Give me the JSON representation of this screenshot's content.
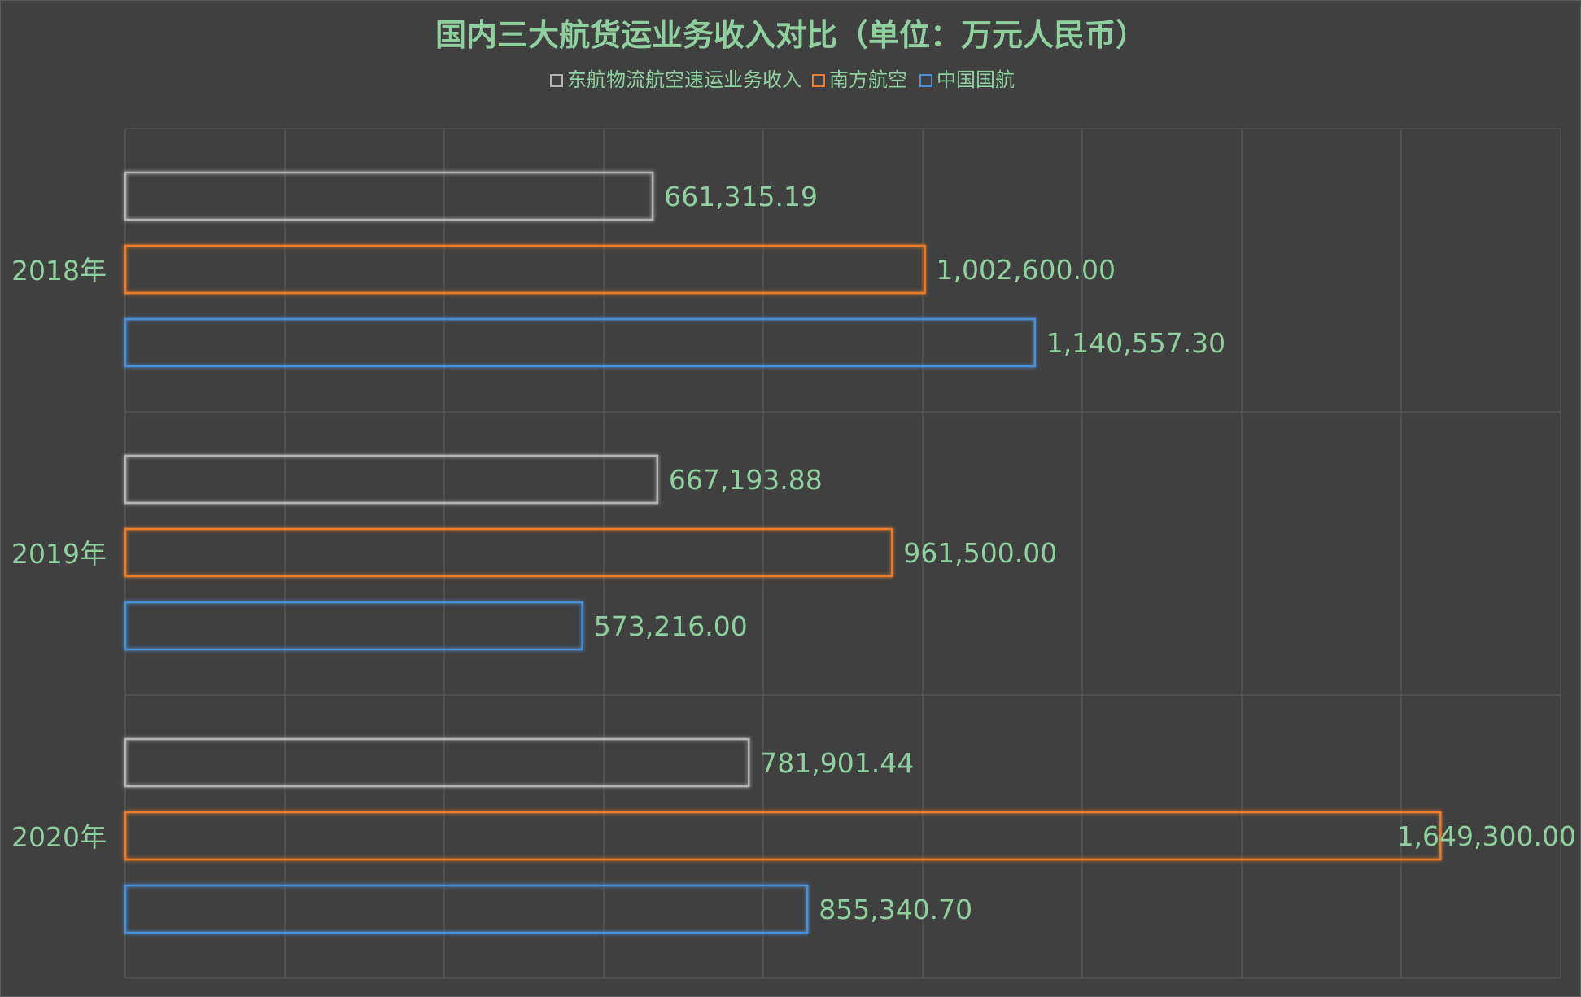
{
  "chart_data": {
    "type": "bar",
    "orientation": "horizontal",
    "title": "国内三大航货运业务收入对比（单位：万元人民币）",
    "categories": [
      "2018年",
      "2019年",
      "2020年"
    ],
    "series": [
      {
        "name": "东航物流航空速运业务收入",
        "color": "#b4b4b4",
        "values": [
          661315.19,
          667193.88,
          781901.44
        ],
        "labels": [
          "661,315.19",
          "667,193.88",
          "781,901.44"
        ]
      },
      {
        "name": "南方航空",
        "color": "#e87b2c",
        "values": [
          1002600.0,
          961500.0,
          1649300.0
        ],
        "labels": [
          "1,002,600.00",
          "961,500.00",
          "1,649,300.00"
        ]
      },
      {
        "name": "中国国航",
        "color": "#4c8fd6",
        "values": [
          1140557.3,
          573216.0,
          855340.7
        ],
        "labels": [
          "1,140,557.30",
          "573,216.00",
          "855,340.70"
        ]
      }
    ],
    "xlim": [
      0,
      1800000
    ],
    "x_gridline_step": 200000,
    "grid": true,
    "legend_position": "top",
    "background": "#404040",
    "text_color": "#8fd19e",
    "gridline_color": "#5a5a5a"
  }
}
